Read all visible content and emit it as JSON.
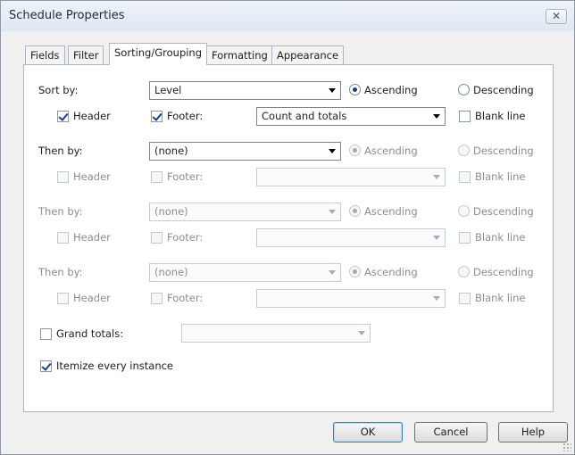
{
  "window": {
    "title": "Schedule Properties",
    "close_glyph": "✕"
  },
  "tabs": [
    {
      "label": "Fields"
    },
    {
      "label": "Filter"
    },
    {
      "label": "Sorting/Grouping"
    },
    {
      "label": "Formatting"
    },
    {
      "label": "Appearance"
    }
  ],
  "active_tab": "Sorting/Grouping",
  "sorting": {
    "sort_by_label": "Sort by:",
    "then_by_label": "Then by:",
    "ascending_label": "Ascending",
    "descending_label": "Descending",
    "header_label": "Header",
    "footer_label": "Footer:",
    "blank_line_label": "Blank line",
    "rows": [
      {
        "field": "Level",
        "order": "ascending",
        "header": true,
        "footer": true,
        "footer_option": "Count and totals",
        "blank_line": false,
        "enabled": true
      },
      {
        "field": "(none)",
        "order": "ascending",
        "header": false,
        "footer": false,
        "footer_option": "",
        "blank_line": false,
        "enabled": true
      },
      {
        "field": "(none)",
        "order": "ascending",
        "header": false,
        "footer": false,
        "footer_option": "",
        "blank_line": false,
        "enabled": false
      },
      {
        "field": "(none)",
        "order": "ascending",
        "header": false,
        "footer": false,
        "footer_option": "",
        "blank_line": false,
        "enabled": false
      }
    ]
  },
  "grand_totals": {
    "label": "Grand totals:",
    "checked": false,
    "value": ""
  },
  "itemize": {
    "label": "Itemize every instance",
    "checked": true
  },
  "buttons": {
    "ok": "OK",
    "cancel": "Cancel",
    "help": "Help"
  },
  "colors": {
    "accent": "#1d3e86",
    "panel": "#ffffff",
    "window": "#f0f0f0"
  }
}
